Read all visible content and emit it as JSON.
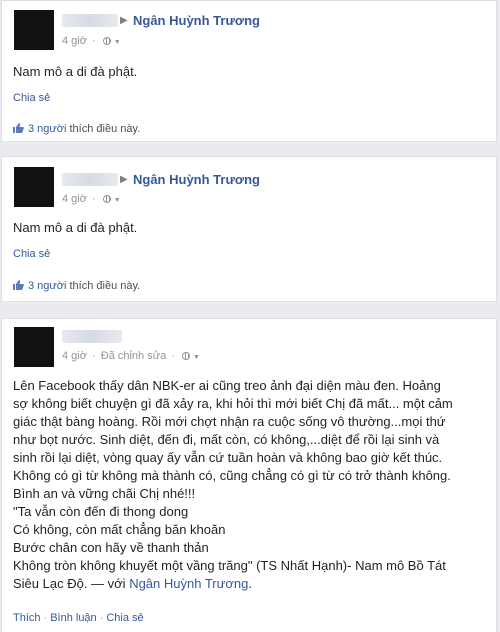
{
  "posts": [
    {
      "target_name": "Ngân Huỳnh Trương",
      "time": "4 giờ",
      "text": "Nam mô a di đà phật.",
      "share_label": "Chia sẻ",
      "likes_count": "3 người",
      "likes_suffix": "thích điều này."
    },
    {
      "target_name": "Ngân Huỳnh Trương",
      "time": "4 giờ",
      "text": "Nam mô a di đà phật.",
      "share_label": "Chia sẻ",
      "likes_count": "3 người",
      "likes_suffix": "thích điều này."
    },
    {
      "time": "4 giờ",
      "edited": "Đã chỉnh sửa",
      "lines": [
        "Lên Facebook thấy dân NBK-er ai cũng treo ảnh đại diện màu đen. Hoảng",
        "sợ không biết chuyện gì đã xảy ra, khi hỏi thì mới biết Chị đã mất... một cảm",
        "giác thật bàng hoàng. Rồi mới chợt nhận ra cuộc sống vô thường...mọi thứ",
        "như bọt nước. Sinh diệt, đến đi, mất còn, có không,...diệt để rồi lại sinh và",
        "sinh rồi lại diệt, vòng quay ấy vẫn cứ tuần hoàn và không bao giờ kết thúc.",
        "Không có gì từ không mà thành có, cũng chẳng có gì từ có trở thành không.",
        "Bình an và vững chãi Chị nhé!!!",
        "\"Ta vẫn còn đến đi thong dong",
        "Có không, còn mất chẳng băn khoăn",
        "Bước chân con hãy về thanh thản",
        "Không tròn không khuyết một vầng trăng\" (TS Nhất Hạnh)- Nam mô Bồ Tát"
      ],
      "last_line_prefix": "Siêu Lạc Độ. — với ",
      "mention": "Ngân Huỳnh Trương",
      "last_line_suffix": ".",
      "like_label": "Thích",
      "comment_label": "Bình luận",
      "share_label": "Chia sẻ",
      "separator": "·"
    }
  ],
  "colors": {
    "link": "#365899",
    "meta": "#90949c",
    "text": "#1d2129",
    "background": "#e9ebee"
  }
}
